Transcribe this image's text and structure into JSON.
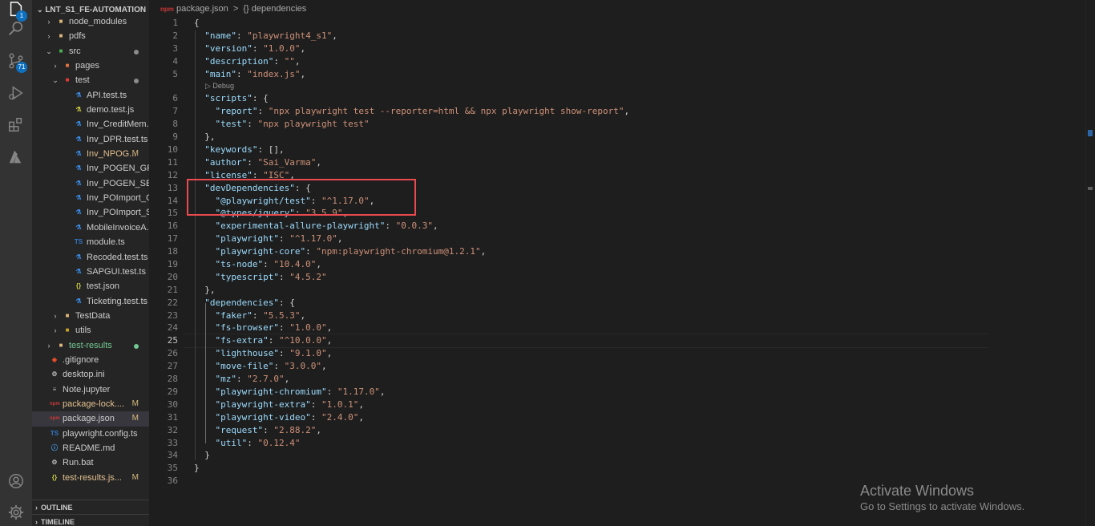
{
  "activity_bar": {
    "items": [
      {
        "name": "explorer-icon",
        "badge": "1"
      },
      {
        "name": "search-icon"
      },
      {
        "name": "source-control-icon",
        "badge": "71"
      },
      {
        "name": "run-debug-icon"
      },
      {
        "name": "extensions-icon"
      },
      {
        "name": "azure-icon"
      }
    ],
    "bottom": [
      {
        "name": "account-icon"
      },
      {
        "name": "settings-gear-icon"
      }
    ]
  },
  "explorer": {
    "title": "LNT_S1_FE-AUTOMATION",
    "items": [
      {
        "label": "node_modules",
        "indent": 1,
        "type": "folder",
        "expanded": false
      },
      {
        "label": "pdfs",
        "indent": 1,
        "type": "folder",
        "expanded": false
      },
      {
        "label": "src",
        "indent": 1,
        "type": "folder-src",
        "expanded": true,
        "status": "dot"
      },
      {
        "label": "pages",
        "indent": 2,
        "type": "folder-pages",
        "expanded": false
      },
      {
        "label": "test",
        "indent": 2,
        "type": "folder-test",
        "expanded": true,
        "status": "dot"
      },
      {
        "label": "API.test.ts",
        "indent": 3,
        "type": "test-ts"
      },
      {
        "label": "demo.test.js",
        "indent": 3,
        "type": "test-js"
      },
      {
        "label": "Inv_CreditMem...",
        "indent": 3,
        "type": "test-ts"
      },
      {
        "label": "Inv_DPR.test.ts",
        "indent": 3,
        "type": "test-ts"
      },
      {
        "label": "Inv_NPOG...",
        "indent": 3,
        "type": "test-ts",
        "status": "M",
        "modified": true
      },
      {
        "label": "Inv_POGEN_GR...",
        "indent": 3,
        "type": "test-ts"
      },
      {
        "label": "Inv_POGEN_SES...",
        "indent": 3,
        "type": "test-ts"
      },
      {
        "label": "Inv_POImport_G...",
        "indent": 3,
        "type": "test-ts"
      },
      {
        "label": "Inv_POImport_S...",
        "indent": 3,
        "type": "test-ts"
      },
      {
        "label": "MobileInvoiceA...",
        "indent": 3,
        "type": "test-ts"
      },
      {
        "label": "module.ts",
        "indent": 3,
        "type": "ts"
      },
      {
        "label": "Recoded.test.ts",
        "indent": 3,
        "type": "test-ts"
      },
      {
        "label": "SAPGUI.test.ts",
        "indent": 3,
        "type": "test-ts"
      },
      {
        "label": "test.json",
        "indent": 3,
        "type": "json"
      },
      {
        "label": "Ticketing.test.ts",
        "indent": 3,
        "type": "test-ts"
      },
      {
        "label": "TestData",
        "indent": 2,
        "type": "folder",
        "expanded": false
      },
      {
        "label": "utils",
        "indent": 2,
        "type": "folder-utils",
        "expanded": false
      },
      {
        "label": "test-results",
        "indent": 1,
        "type": "folder",
        "expanded": false,
        "status": "dot-green",
        "untracked": true
      },
      {
        "label": ".gitignore",
        "indent": 1,
        "type": "git"
      },
      {
        "label": "desktop.ini",
        "indent": 1,
        "type": "ini"
      },
      {
        "label": "Note.jupyter",
        "indent": 1,
        "type": "file"
      },
      {
        "label": "package-lock....",
        "indent": 1,
        "type": "npm",
        "status": "M",
        "modified": true
      },
      {
        "label": "package.json",
        "indent": 1,
        "type": "npm",
        "status": "M",
        "selected": true
      },
      {
        "label": "playwright.config.ts",
        "indent": 1,
        "type": "ts"
      },
      {
        "label": "README.md",
        "indent": 1,
        "type": "md"
      },
      {
        "label": "Run.bat",
        "indent": 1,
        "type": "bat"
      },
      {
        "label": "test-results.js...",
        "indent": 1,
        "type": "json",
        "status": "M",
        "modified": true
      }
    ],
    "outline_label": "OUTLINE",
    "timeline_label": "TIMELINE"
  },
  "breadcrumb": {
    "file": "package.json",
    "separator": ">",
    "section_icon": "{}",
    "section": "dependencies"
  },
  "editor": {
    "active_line": 25,
    "codelens_after_line": 5,
    "codelens_text": "▷ Debug",
    "lines": [
      {
        "n": "1",
        "t": [
          [
            "p",
            "{"
          ]
        ]
      },
      {
        "n": "2",
        "t": [
          [
            "p",
            "  "
          ],
          [
            "k",
            "\"name\""
          ],
          [
            "p",
            ": "
          ],
          [
            "s",
            "\"playwright4_s1\""
          ],
          [
            "p",
            ","
          ]
        ]
      },
      {
        "n": "3",
        "t": [
          [
            "p",
            "  "
          ],
          [
            "k",
            "\"version\""
          ],
          [
            "p",
            ": "
          ],
          [
            "s",
            "\"1.0.0\""
          ],
          [
            "p",
            ","
          ]
        ]
      },
      {
        "n": "4",
        "t": [
          [
            "p",
            "  "
          ],
          [
            "k",
            "\"description\""
          ],
          [
            "p",
            ": "
          ],
          [
            "s",
            "\"\""
          ],
          [
            "p",
            ","
          ]
        ]
      },
      {
        "n": "5",
        "t": [
          [
            "p",
            "  "
          ],
          [
            "k",
            "\"main\""
          ],
          [
            "p",
            ": "
          ],
          [
            "s",
            "\"index.js\""
          ],
          [
            "p",
            ","
          ]
        ]
      },
      {
        "n": "6",
        "t": [
          [
            "p",
            "  "
          ],
          [
            "k",
            "\"scripts\""
          ],
          [
            "p",
            ": {"
          ]
        ]
      },
      {
        "n": "7",
        "t": [
          [
            "p",
            "    "
          ],
          [
            "k",
            "\"report\""
          ],
          [
            "p",
            ": "
          ],
          [
            "s",
            "\"npx playwright test --reporter=html && npx playwright show-report\""
          ],
          [
            "p",
            ","
          ]
        ]
      },
      {
        "n": "8",
        "t": [
          [
            "p",
            "    "
          ],
          [
            "k",
            "\"test\""
          ],
          [
            "p",
            ": "
          ],
          [
            "s",
            "\"npx playwright test\""
          ]
        ]
      },
      {
        "n": "9",
        "t": [
          [
            "p",
            "  },"
          ]
        ]
      },
      {
        "n": "10",
        "t": [
          [
            "p",
            "  "
          ],
          [
            "k",
            "\"keywords\""
          ],
          [
            "p",
            ": [],"
          ]
        ]
      },
      {
        "n": "11",
        "t": [
          [
            "p",
            "  "
          ],
          [
            "k",
            "\"author\""
          ],
          [
            "p",
            ": "
          ],
          [
            "s",
            "\"Sai_Varma\""
          ],
          [
            "p",
            ","
          ]
        ]
      },
      {
        "n": "12",
        "t": [
          [
            "p",
            "  "
          ],
          [
            "k",
            "\"license\""
          ],
          [
            "p",
            ": "
          ],
          [
            "s",
            "\"ISC\""
          ],
          [
            "p",
            ","
          ]
        ]
      },
      {
        "n": "13",
        "t": [
          [
            "p",
            "  "
          ],
          [
            "k",
            "\"devDependencies\""
          ],
          [
            "p",
            ": {"
          ]
        ]
      },
      {
        "n": "14",
        "t": [
          [
            "p",
            "    "
          ],
          [
            "k",
            "\"@playwright/test\""
          ],
          [
            "p",
            ": "
          ],
          [
            "s",
            "\"^1.17.0\""
          ],
          [
            "p",
            ","
          ]
        ]
      },
      {
        "n": "15",
        "t": [
          [
            "p",
            "    "
          ],
          [
            "k",
            "\"@types/jquery\""
          ],
          [
            "p",
            ": "
          ],
          [
            "s",
            "\"3.5.9\""
          ],
          [
            "p",
            ","
          ]
        ]
      },
      {
        "n": "16",
        "t": [
          [
            "p",
            "    "
          ],
          [
            "k",
            "\"experimental-allure-playwright\""
          ],
          [
            "p",
            ": "
          ],
          [
            "s",
            "\"0.0.3\""
          ],
          [
            "p",
            ","
          ]
        ]
      },
      {
        "n": "17",
        "t": [
          [
            "p",
            "    "
          ],
          [
            "k",
            "\"playwright\""
          ],
          [
            "p",
            ": "
          ],
          [
            "s",
            "\"^1.17.0\""
          ],
          [
            "p",
            ","
          ]
        ]
      },
      {
        "n": "18",
        "t": [
          [
            "p",
            "    "
          ],
          [
            "k",
            "\"playwright-core\""
          ],
          [
            "p",
            ": "
          ],
          [
            "s",
            "\"npm:playwright-chromium@1.2.1\""
          ],
          [
            "p",
            ","
          ]
        ]
      },
      {
        "n": "19",
        "t": [
          [
            "p",
            "    "
          ],
          [
            "k",
            "\"ts-node\""
          ],
          [
            "p",
            ": "
          ],
          [
            "s",
            "\"10.4.0\""
          ],
          [
            "p",
            ","
          ]
        ]
      },
      {
        "n": "20",
        "t": [
          [
            "p",
            "    "
          ],
          [
            "k",
            "\"typescript\""
          ],
          [
            "p",
            ": "
          ],
          [
            "s",
            "\"4.5.2\""
          ]
        ]
      },
      {
        "n": "21",
        "t": [
          [
            "p",
            "  },"
          ]
        ]
      },
      {
        "n": "22",
        "t": [
          [
            "p",
            "  "
          ],
          [
            "k",
            "\"dependencies\""
          ],
          [
            "p",
            ": {"
          ]
        ]
      },
      {
        "n": "23",
        "t": [
          [
            "p",
            "    "
          ],
          [
            "k",
            "\"faker\""
          ],
          [
            "p",
            ": "
          ],
          [
            "s",
            "\"5.5.3\""
          ],
          [
            "p",
            ","
          ]
        ]
      },
      {
        "n": "24",
        "t": [
          [
            "p",
            "    "
          ],
          [
            "k",
            "\"fs-browser\""
          ],
          [
            "p",
            ": "
          ],
          [
            "s",
            "\"1.0.0\""
          ],
          [
            "p",
            ","
          ]
        ]
      },
      {
        "n": "25",
        "t": [
          [
            "p",
            "    "
          ],
          [
            "k",
            "\"fs-extra\""
          ],
          [
            "p",
            ": "
          ],
          [
            "s",
            "\"^10.0.0\""
          ],
          [
            "p",
            ","
          ]
        ]
      },
      {
        "n": "26",
        "t": [
          [
            "p",
            "    "
          ],
          [
            "k",
            "\"lighthouse\""
          ],
          [
            "p",
            ": "
          ],
          [
            "s",
            "\"9.1.0\""
          ],
          [
            "p",
            ","
          ]
        ]
      },
      {
        "n": "27",
        "t": [
          [
            "p",
            "    "
          ],
          [
            "k",
            "\"move-file\""
          ],
          [
            "p",
            ": "
          ],
          [
            "s",
            "\"3.0.0\""
          ],
          [
            "p",
            ","
          ]
        ]
      },
      {
        "n": "28",
        "t": [
          [
            "p",
            "    "
          ],
          [
            "k",
            "\"mz\""
          ],
          [
            "p",
            ": "
          ],
          [
            "s",
            "\"2.7.0\""
          ],
          [
            "p",
            ","
          ]
        ]
      },
      {
        "n": "29",
        "t": [
          [
            "p",
            "    "
          ],
          [
            "k",
            "\"playwright-chromium\""
          ],
          [
            "p",
            ": "
          ],
          [
            "s",
            "\"1.17.0\""
          ],
          [
            "p",
            ","
          ]
        ]
      },
      {
        "n": "30",
        "t": [
          [
            "p",
            "    "
          ],
          [
            "k",
            "\"playwright-extra\""
          ],
          [
            "p",
            ": "
          ],
          [
            "s",
            "\"1.0.1\""
          ],
          [
            "p",
            ","
          ]
        ]
      },
      {
        "n": "31",
        "t": [
          [
            "p",
            "    "
          ],
          [
            "k",
            "\"playwright-video\""
          ],
          [
            "p",
            ": "
          ],
          [
            "s",
            "\"2.4.0\""
          ],
          [
            "p",
            ","
          ]
        ]
      },
      {
        "n": "32",
        "t": [
          [
            "p",
            "    "
          ],
          [
            "k",
            "\"request\""
          ],
          [
            "p",
            ": "
          ],
          [
            "s",
            "\"2.88.2\""
          ],
          [
            "p",
            ","
          ]
        ]
      },
      {
        "n": "33",
        "t": [
          [
            "p",
            "    "
          ],
          [
            "k",
            "\"util\""
          ],
          [
            "p",
            ": "
          ],
          [
            "s",
            "\"0.12.4\""
          ]
        ]
      },
      {
        "n": "34",
        "t": [
          [
            "p",
            "  }"
          ]
        ]
      },
      {
        "n": "35",
        "t": [
          [
            "p",
            "}"
          ]
        ]
      },
      {
        "n": "36",
        "t": []
      }
    ]
  },
  "watermark": {
    "title": "Activate Windows",
    "subtitle": "Go to Settings to activate Windows."
  },
  "colors": {
    "key": "#9cdcfe",
    "string": "#ce9178",
    "punct": "#d4d4d4",
    "highlight_box": "#e84a4f",
    "modified": "#e2c08d",
    "untracked": "#73c991"
  }
}
